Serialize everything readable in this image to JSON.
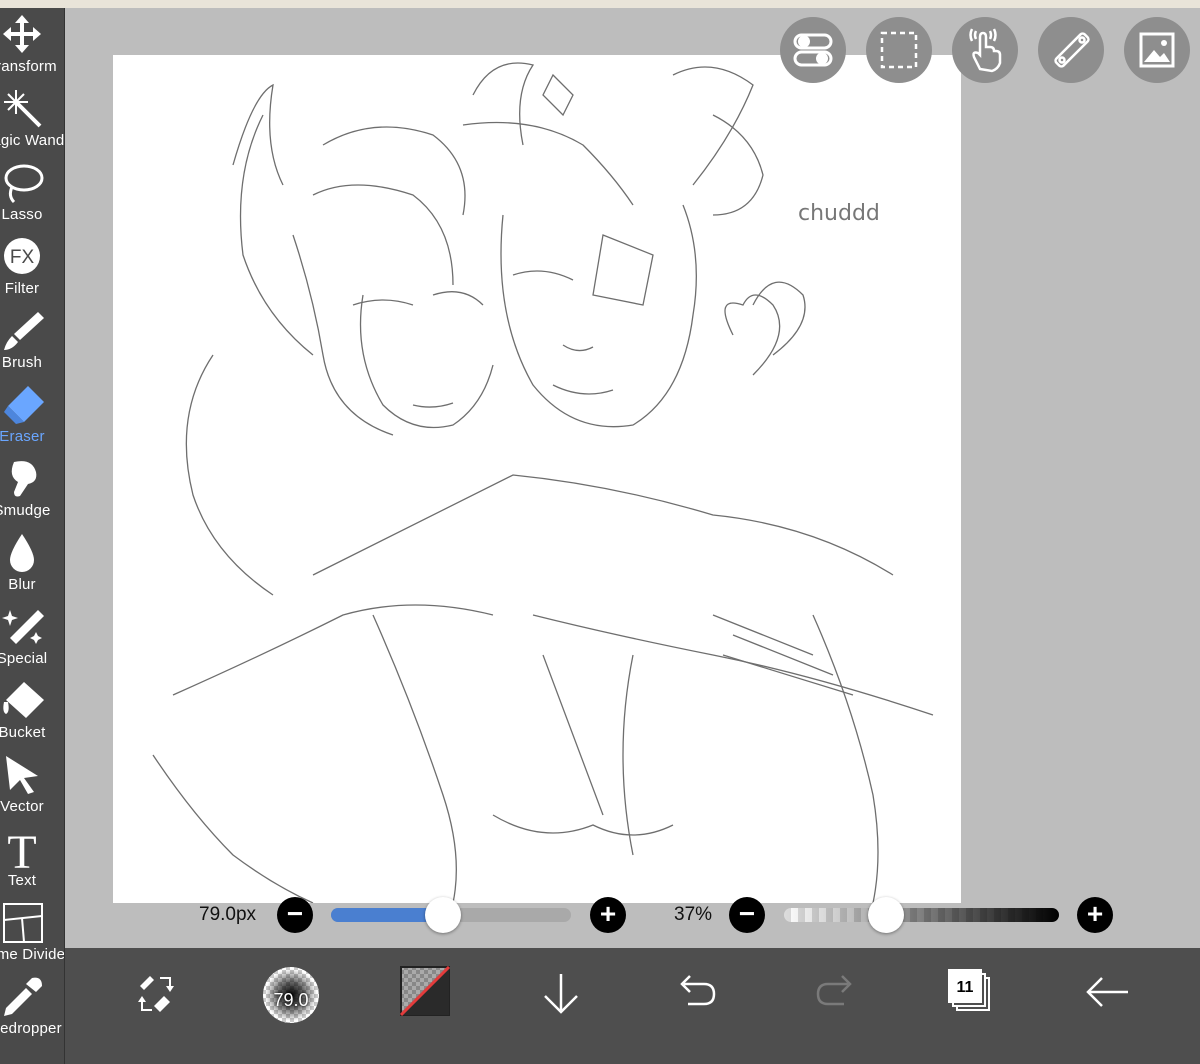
{
  "sidebar": {
    "tools": [
      {
        "label": "Transform",
        "icon": "move-arrows-icon"
      },
      {
        "label": "Magic Wand",
        "icon": "magic-wand-icon"
      },
      {
        "label": "Lasso",
        "icon": "lasso-icon"
      },
      {
        "label": "Filter",
        "icon": "fx-filter-icon"
      },
      {
        "label": "Brush",
        "icon": "brush-icon"
      },
      {
        "label": "Eraser",
        "icon": "eraser-icon",
        "active": true
      },
      {
        "label": "Smudge",
        "icon": "smudge-icon"
      },
      {
        "label": "Blur",
        "icon": "blur-drop-icon"
      },
      {
        "label": "Special",
        "icon": "special-sparkle-icon"
      },
      {
        "label": "Bucket",
        "icon": "bucket-icon"
      },
      {
        "label": "Vector",
        "icon": "vector-arrow-icon"
      },
      {
        "label": "Text",
        "icon": "text-t-icon"
      },
      {
        "label": "Frame Divider",
        "icon": "frame-divider-icon"
      },
      {
        "label": "Eyedropper",
        "icon": "eyedropper-icon"
      }
    ],
    "active_color": "#6aa6ff"
  },
  "top_buttons": [
    "toggle-icon",
    "selection-icon",
    "hand-gesture-icon",
    "ruler-icon",
    "image-icon"
  ],
  "canvas": {
    "annotation": "chuddd"
  },
  "brush_size": {
    "value_label": "79.0px",
    "minus": "−",
    "plus": "+",
    "level": 0.5
  },
  "opacity": {
    "value_label": "37%",
    "minus": "−",
    "plus": "+",
    "level": 0.37
  },
  "bottom_bar": {
    "brush_preview_label": "79.0",
    "layers_count": "11",
    "buttons": [
      "swap-brush-eraser-icon",
      "brush-preview-icon",
      "color-swatch-icon",
      "download-icon",
      "undo-icon",
      "redo-icon",
      "layers-icon",
      "back-icon"
    ]
  },
  "colors": {
    "sidebar": "#4a4a4a",
    "workspace": "#bdbdbd",
    "bottom_bar": "#4e4e4e",
    "slider_fill": "#4a7fd0"
  }
}
